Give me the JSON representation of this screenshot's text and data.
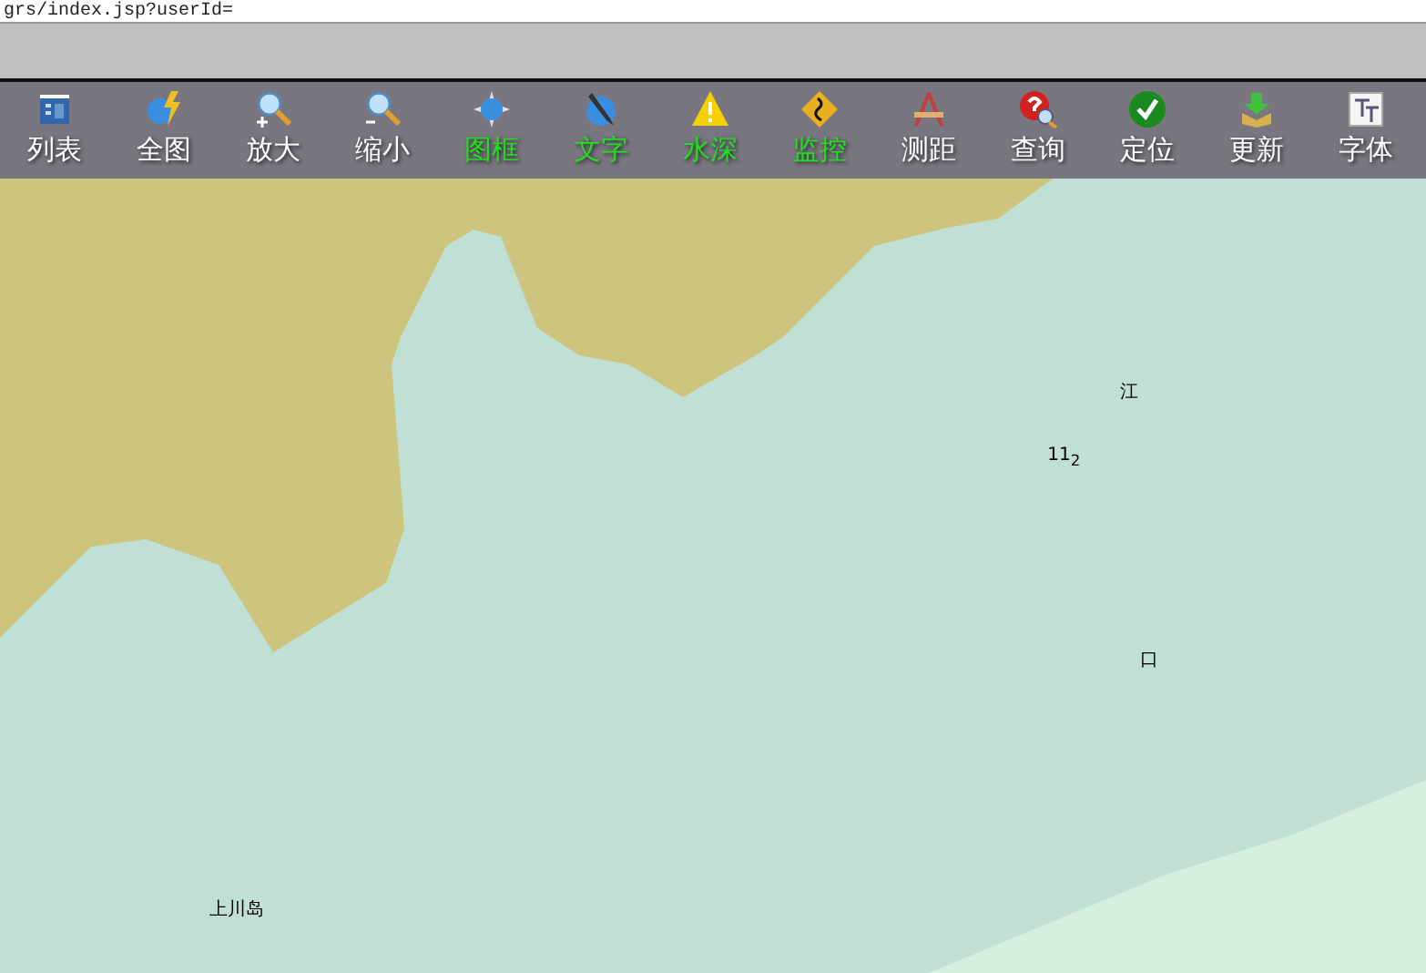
{
  "browser": {
    "address": "grs/index.jsp?userId="
  },
  "toolbar": [
    {
      "label": "列表",
      "kind": "list",
      "highlighted": false
    },
    {
      "label": "全图",
      "kind": "globe-bolt",
      "highlighted": false
    },
    {
      "label": "放大",
      "kind": "zoom-in",
      "highlighted": false
    },
    {
      "label": "缩小",
      "kind": "zoom-out",
      "highlighted": false
    },
    {
      "label": "图框",
      "kind": "frame",
      "highlighted": true
    },
    {
      "label": "文字",
      "kind": "pen",
      "highlighted": true
    },
    {
      "label": "水深",
      "kind": "warning",
      "highlighted": true
    },
    {
      "label": "监控",
      "kind": "road-sign",
      "highlighted": true
    },
    {
      "label": "测距",
      "kind": "compass",
      "highlighted": false
    },
    {
      "label": "查询",
      "kind": "query",
      "highlighted": false
    },
    {
      "label": "定位",
      "kind": "check",
      "highlighted": false
    },
    {
      "label": "更新",
      "kind": "download",
      "highlighted": false
    },
    {
      "label": "字体",
      "kind": "font",
      "highlighted": false
    }
  ],
  "map": {
    "labels": [
      {
        "text": "江"
      },
      {
        "text": "11$_{2}$"
      },
      {
        "text": "口"
      },
      {
        "text": "上川岛"
      }
    ]
  }
}
